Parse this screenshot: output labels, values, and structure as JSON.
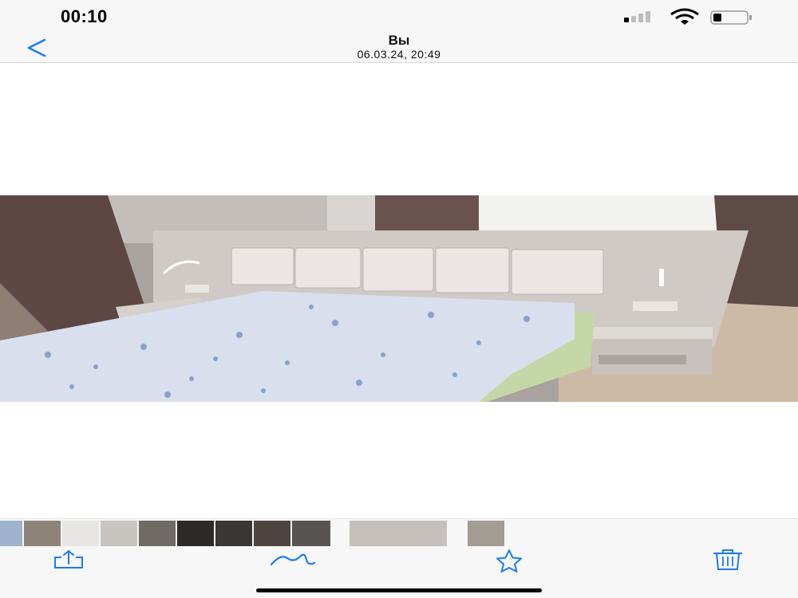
{
  "status_bar": {
    "time": "00:10",
    "icons": [
      "cellular-signal-icon",
      "wifi-icon",
      "battery-icon"
    ]
  },
  "nav": {
    "back_icon": "chevron-left-icon",
    "title": "Вы",
    "subtitle": "06.03.24, 20:49"
  },
  "photo": {
    "subject": "bedroom-bed-photo"
  },
  "thumbnails": {
    "count": 11
  },
  "toolbar": {
    "items": [
      "share-icon",
      "markup-icon",
      "star-icon",
      "trash-icon"
    ]
  },
  "colors": {
    "accent": "#1a7cf5",
    "bar_background": "#f7f7f7",
    "text": "#111111"
  }
}
